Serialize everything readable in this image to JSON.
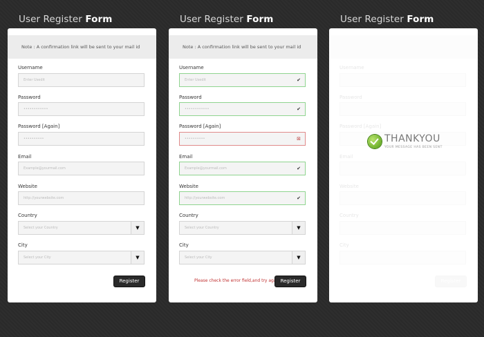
{
  "panels": [
    {
      "title_prefix": "User Register ",
      "title_bold": "Form",
      "note": "Note : A confirmation link will be sent to your mail id",
      "fields": [
        {
          "label": "Username",
          "placeholder": "Enter Usedit",
          "type": "text"
        },
        {
          "label": "Password",
          "placeholder": "••••••••••••",
          "type": "text"
        },
        {
          "label": "Password [Again]",
          "placeholder": "••••••••••",
          "type": "text"
        },
        {
          "label": "Email",
          "placeholder": "Example@yourmail.com",
          "type": "text"
        },
        {
          "label": "Website",
          "placeholder": "http://yourwebsite.com",
          "type": "text"
        },
        {
          "label": "Country",
          "placeholder": "Select your Country",
          "type": "select"
        },
        {
          "label": "City",
          "placeholder": "Select your City",
          "type": "select"
        }
      ],
      "register_label": "Register"
    },
    {
      "title_prefix": "User Register ",
      "title_bold": "Form",
      "note": "Note : A confirmation link will be sent to your mail id",
      "fields": [
        {
          "label": "Username",
          "placeholder": "Enter Usedit",
          "type": "text",
          "state": "ok"
        },
        {
          "label": "Password",
          "placeholder": "••••••••••••",
          "type": "text",
          "state": "ok"
        },
        {
          "label": "Password [Again]",
          "placeholder": "••••••••••",
          "type": "text",
          "state": "error"
        },
        {
          "label": "Email",
          "placeholder": "Example@yourmail.com",
          "type": "text",
          "state": "ok"
        },
        {
          "label": "Website",
          "placeholder": "http://yourwebsite.com",
          "type": "text",
          "state": "ok"
        },
        {
          "label": "Country",
          "placeholder": "Select your Country",
          "type": "select"
        },
        {
          "label": "City",
          "placeholder": "Select your City",
          "type": "select"
        }
      ],
      "error_message": "Please check the error field,and try again",
      "register_label": "Register"
    },
    {
      "title_prefix": "User Register ",
      "title_bold": "Form",
      "thankyou": "THANKYOU",
      "thankyou_sub": "YOUR MESSAGE HAS BEEN SENT",
      "fields": [
        {
          "label": "Username"
        },
        {
          "label": "Password"
        },
        {
          "label": "Password [Again]"
        },
        {
          "label": "Email"
        },
        {
          "label": "Website"
        },
        {
          "label": "Country"
        },
        {
          "label": "City"
        }
      ],
      "register_label": "Register"
    }
  ],
  "icons": {
    "ok": "check-icon",
    "error": "error-icon",
    "select": "dropdown-arrow-icon",
    "thankyou": "check-circle-icon"
  },
  "colors": {
    "ok_border": "#8fd48f",
    "error_border": "#e08a8a",
    "error_text": "#c03030",
    "button_bg": "#2a2a2a"
  }
}
